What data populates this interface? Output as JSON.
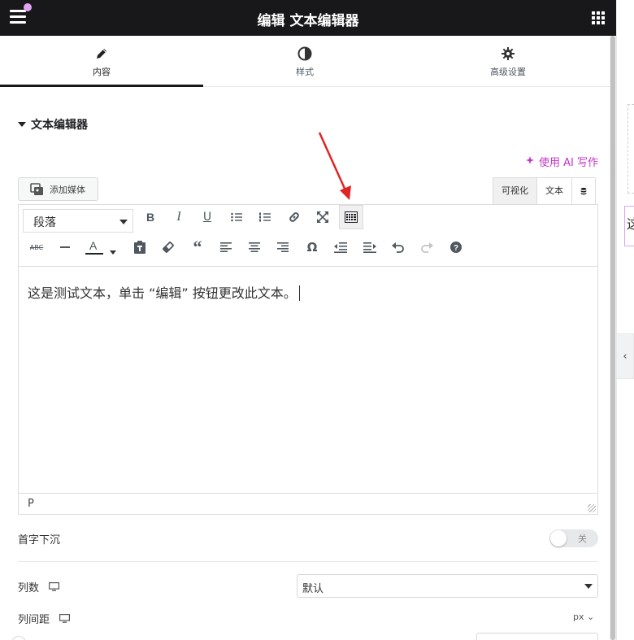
{
  "header": {
    "title": "编辑 文本编辑器"
  },
  "tabs": [
    {
      "label": "内容",
      "icon": "pencil-icon",
      "active": true
    },
    {
      "label": "样式",
      "icon": "half-circle-icon",
      "active": false
    },
    {
      "label": "高级设置",
      "icon": "gear-icon",
      "active": false
    }
  ],
  "section": {
    "title": "文本编辑器"
  },
  "ai": {
    "label": "使用 AI 写作"
  },
  "editor": {
    "add_media_label": "添加媒体",
    "mode_tabs": [
      "可视化",
      "文本"
    ],
    "format_value": "段落",
    "content": "这是测试文本，单击 “编辑” 按钮更改此文本。",
    "status_path": "P",
    "icons_row1": [
      "bold-icon",
      "italic-icon",
      "underline-icon",
      "bullet-list-icon",
      "numbered-list-icon",
      "link-icon",
      "fullscreen-icon",
      "toolbar-toggle-icon"
    ],
    "icons_row2": [
      "strikethrough-icon",
      "horizontal-line-icon",
      "text-color-icon",
      "paste-text-icon",
      "clear-formatting-icon",
      "blockquote-icon",
      "align-left-icon",
      "align-center-icon",
      "align-right-icon",
      "special-character-icon",
      "outdent-icon",
      "indent-icon",
      "undo-icon",
      "redo-icon",
      "help-icon"
    ]
  },
  "drop_cap": {
    "label": "首字下沉",
    "toggle_label": "关",
    "on": false
  },
  "columns": {
    "label": "列数",
    "value": "默认"
  },
  "column_gap": {
    "label": "列间距",
    "unit": "px"
  },
  "preview": {
    "text": "这"
  },
  "colors": {
    "accent": "#c433c9",
    "header_bg": "#18181b",
    "arrow": "#e02424"
  }
}
